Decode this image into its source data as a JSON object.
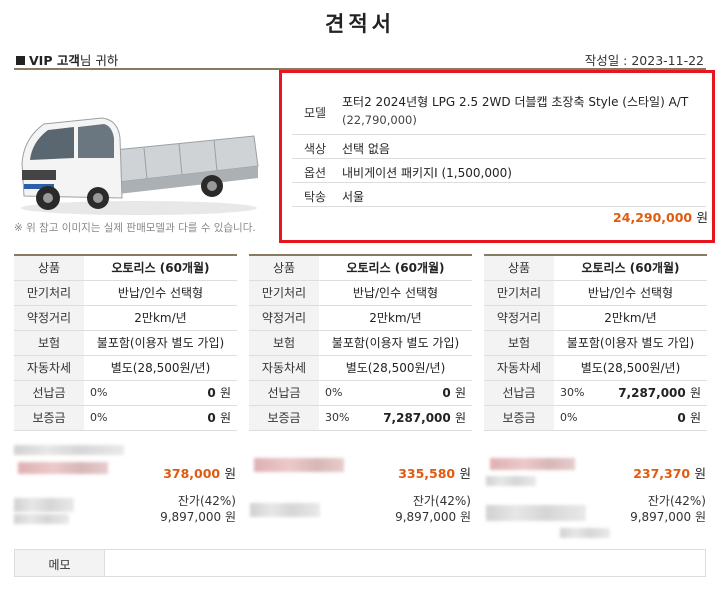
{
  "title": "견적서",
  "header": {
    "customer_prefix": "VIP 고객",
    "customer_suffix": "님 귀하",
    "date": "작성일 : 2023-11-22"
  },
  "image_note": "※ 위 참고 이미지는 실제 판매모델과 다를 수 있습니다.",
  "spec": {
    "model_label": "모델",
    "model_value": "포터2 2024년형 LPG 2.5 2WD 더블캡 초장축 Style (스타일) A/T",
    "model_price": "(22,790,000)",
    "color_label": "색상",
    "color_value": "선택 없음",
    "option_label": "옵션",
    "option_value": "내비게이션 패키지Ⅰ (1,500,000)",
    "delivery_label": "탁송",
    "delivery_value": "서울",
    "total_amount": "24,290,000",
    "total_unit": "원"
  },
  "labels": {
    "product": "상품",
    "maturity": "만기처리",
    "distance": "약정거리",
    "insurance": "보험",
    "car_tax": "자동차세",
    "advance": "선납금",
    "deposit": "보증금",
    "memo": "메모",
    "won": "원"
  },
  "options": [
    {
      "product": "오토리스 (60개월)",
      "maturity": "반납/인수 선택형",
      "distance": "2만km/년",
      "insurance": "불포함(이용자 별도 가입)",
      "car_tax": "별도(28,500원/년)",
      "advance_pct": "0%",
      "advance_amt": "0",
      "deposit_pct": "0%",
      "deposit_amt": "0",
      "monthly": "378,000",
      "residual_label": "잔가(42%)",
      "residual_amt": "9,897,000 원"
    },
    {
      "product": "오토리스 (60개월)",
      "maturity": "반납/인수 선택형",
      "distance": "2만km/년",
      "insurance": "불포함(이용자 별도 가입)",
      "car_tax": "별도(28,500원/년)",
      "advance_pct": "0%",
      "advance_amt": "0",
      "deposit_pct": "30%",
      "deposit_amt": "7,287,000",
      "monthly": "335,580",
      "residual_label": "잔가(42%)",
      "residual_amt": "9,897,000 원"
    },
    {
      "product": "오토리스 (60개월)",
      "maturity": "반납/인수 선택형",
      "distance": "2만km/년",
      "insurance": "불포함(이용자 별도 가입)",
      "car_tax": "별도(28,500원/년)",
      "advance_pct": "30%",
      "advance_amt": "7,287,000",
      "deposit_pct": "0%",
      "deposit_amt": "0",
      "monthly": "237,370",
      "residual_label": "잔가(42%)",
      "residual_amt": "9,897,000 원"
    }
  ],
  "colors": {
    "accent": "#e05a10",
    "frame": "#e8141e",
    "rule": "#8a7a62"
  }
}
